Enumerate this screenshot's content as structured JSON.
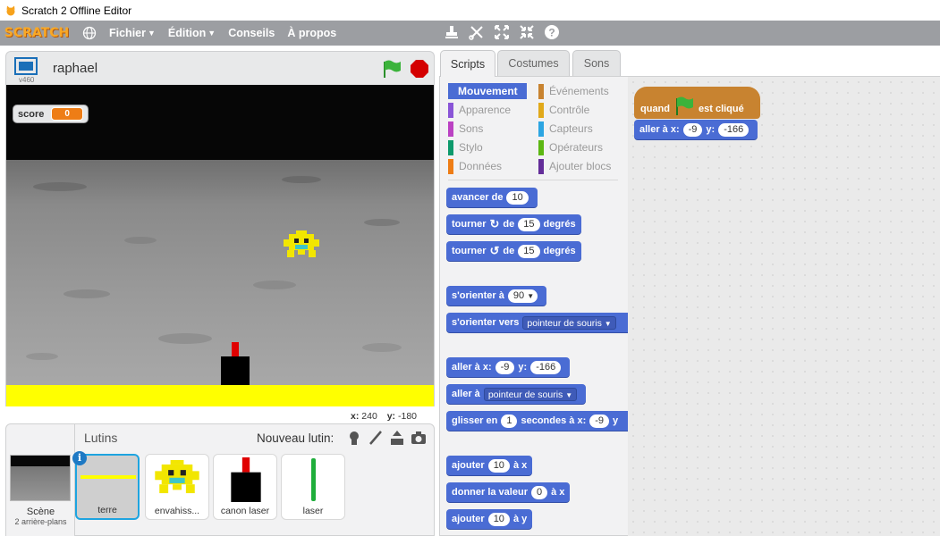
{
  "window": {
    "title": "Scratch 2 Offline Editor"
  },
  "menubar": {
    "logo": "SCRATCH",
    "items": [
      "Fichier",
      "Édition",
      "Conseils",
      "À propos"
    ]
  },
  "stage": {
    "version": "v460",
    "project_name": "raphael",
    "score_monitor": {
      "label": "score",
      "value": "0"
    },
    "coords": {
      "x_label": "x:",
      "x": "240",
      "y_label": "y:",
      "y": "-180"
    }
  },
  "sprites": {
    "title": "Lutins",
    "new_sprite_label": "Nouveau lutin:",
    "scene": {
      "label": "Scène",
      "sub": "2 arrière-plans"
    },
    "list": [
      {
        "name": "terre",
        "selected": true
      },
      {
        "name": "envahiss..."
      },
      {
        "name": "canon laser"
      },
      {
        "name": "laser"
      }
    ]
  },
  "tabs": [
    "Scripts",
    "Costumes",
    "Sons"
  ],
  "categories": [
    {
      "label": "Mouvement",
      "color": "#4a6cd4",
      "active": true
    },
    {
      "label": "Apparence",
      "color": "#8a55d7"
    },
    {
      "label": "Sons",
      "color": "#bb42c3"
    },
    {
      "label": "Stylo",
      "color": "#0e9a6c"
    },
    {
      "label": "Données",
      "color": "#ee7d16"
    },
    {
      "label": "Événements",
      "color": "#c88330"
    },
    {
      "label": "Contrôle",
      "color": "#e1a91a"
    },
    {
      "label": "Capteurs",
      "color": "#2ca5e2"
    },
    {
      "label": "Opérateurs",
      "color": "#5cb712"
    },
    {
      "label": "Ajouter blocs",
      "color": "#632d99"
    }
  ],
  "blocks": {
    "move": {
      "a": "avancer de",
      "v": "10"
    },
    "turn_right": {
      "a": "tourner",
      "b": "de",
      "v": "15",
      "c": "degrés"
    },
    "turn_left": {
      "a": "tourner",
      "b": "de",
      "v": "15",
      "c": "degrés"
    },
    "point_dir": {
      "a": "s'orienter à",
      "v": "90"
    },
    "point_towards": {
      "a": "s'orienter vers",
      "v": "pointeur de souris"
    },
    "goto_xy": {
      "a": "aller à x:",
      "x": "-9",
      "b": "y:",
      "y": "-166"
    },
    "goto": {
      "a": "aller à",
      "v": "pointeur de souris"
    },
    "glide": {
      "a": "glisser en",
      "v": "1",
      "b": "secondes à x:",
      "x": "-9",
      "c": "y"
    },
    "change_x": {
      "a": "ajouter",
      "v": "10",
      "b": "à x"
    },
    "set_x": {
      "a": "donner la valeur",
      "v": "0",
      "b": "à x"
    },
    "change_y": {
      "a": "ajouter",
      "v": "10",
      "b": "à y"
    }
  },
  "script": {
    "hat": {
      "a": "quand",
      "b": "est cliqué"
    },
    "goto": {
      "a": "aller à x:",
      "x": "-9",
      "b": "y:",
      "y": "-166"
    }
  }
}
